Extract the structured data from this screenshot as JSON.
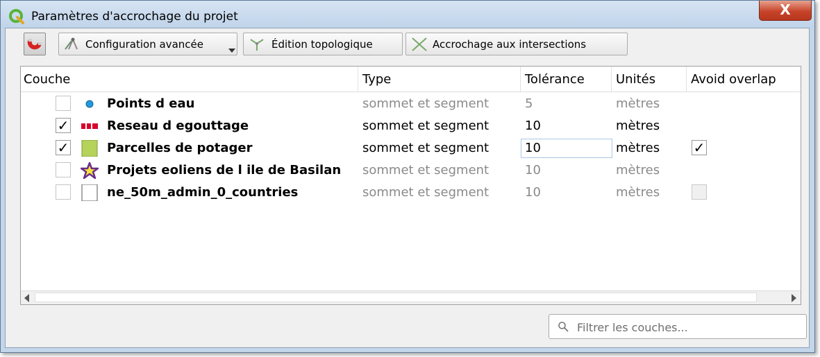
{
  "window": {
    "title": "Paramètres d'accrochage du projet",
    "close_label": "X"
  },
  "toolbar": {
    "magnet_icon": "magnet-icon",
    "advanced_config_label": "Configuration avancée",
    "topo_edit_label": "Édition topologique",
    "intersection_snap_label": "Accrochage aux intersections"
  },
  "table": {
    "headers": [
      "Couche",
      "Type",
      "Tolérance",
      "Unités",
      "Avoid overlap"
    ],
    "rows": [
      {
        "checked": false,
        "symbol": "point-circle-blue",
        "name": "Points d eau",
        "type": "sommet et segment",
        "tolerance": "5",
        "units": "mètres",
        "avoid_overlap": null,
        "enabled": false
      },
      {
        "checked": true,
        "symbol": "line-red-dashed",
        "name": "Reseau d egouttage",
        "type": "sommet et segment",
        "tolerance": "10",
        "units": "mètres",
        "avoid_overlap": null,
        "enabled": true
      },
      {
        "checked": true,
        "symbol": "polygon-green",
        "name": "Parcelles de potager",
        "type": "sommet et segment",
        "tolerance": "10",
        "units": "mètres",
        "avoid_overlap": true,
        "enabled": true
      },
      {
        "checked": false,
        "symbol": "star-purple",
        "name": "Projets eoliens de l ile de Basilan",
        "type": "sommet et segment",
        "tolerance": "10",
        "units": "mètres",
        "avoid_overlap": null,
        "enabled": false
      },
      {
        "checked": false,
        "symbol": "polygon-white",
        "name": "ne_50m_admin_0_countries",
        "type": "sommet et segment",
        "tolerance": "10",
        "units": "mètres",
        "avoid_overlap": false,
        "enabled": false
      }
    ]
  },
  "filter": {
    "placeholder": "Filtrer les couches...",
    "value": ""
  },
  "colors": {
    "point_blue": "#1f9be0",
    "line_red": "#d8002a",
    "polygon_green": "#b5d25a",
    "star_purple": "#6b2c8c",
    "star_fill": "#f3e33b"
  }
}
